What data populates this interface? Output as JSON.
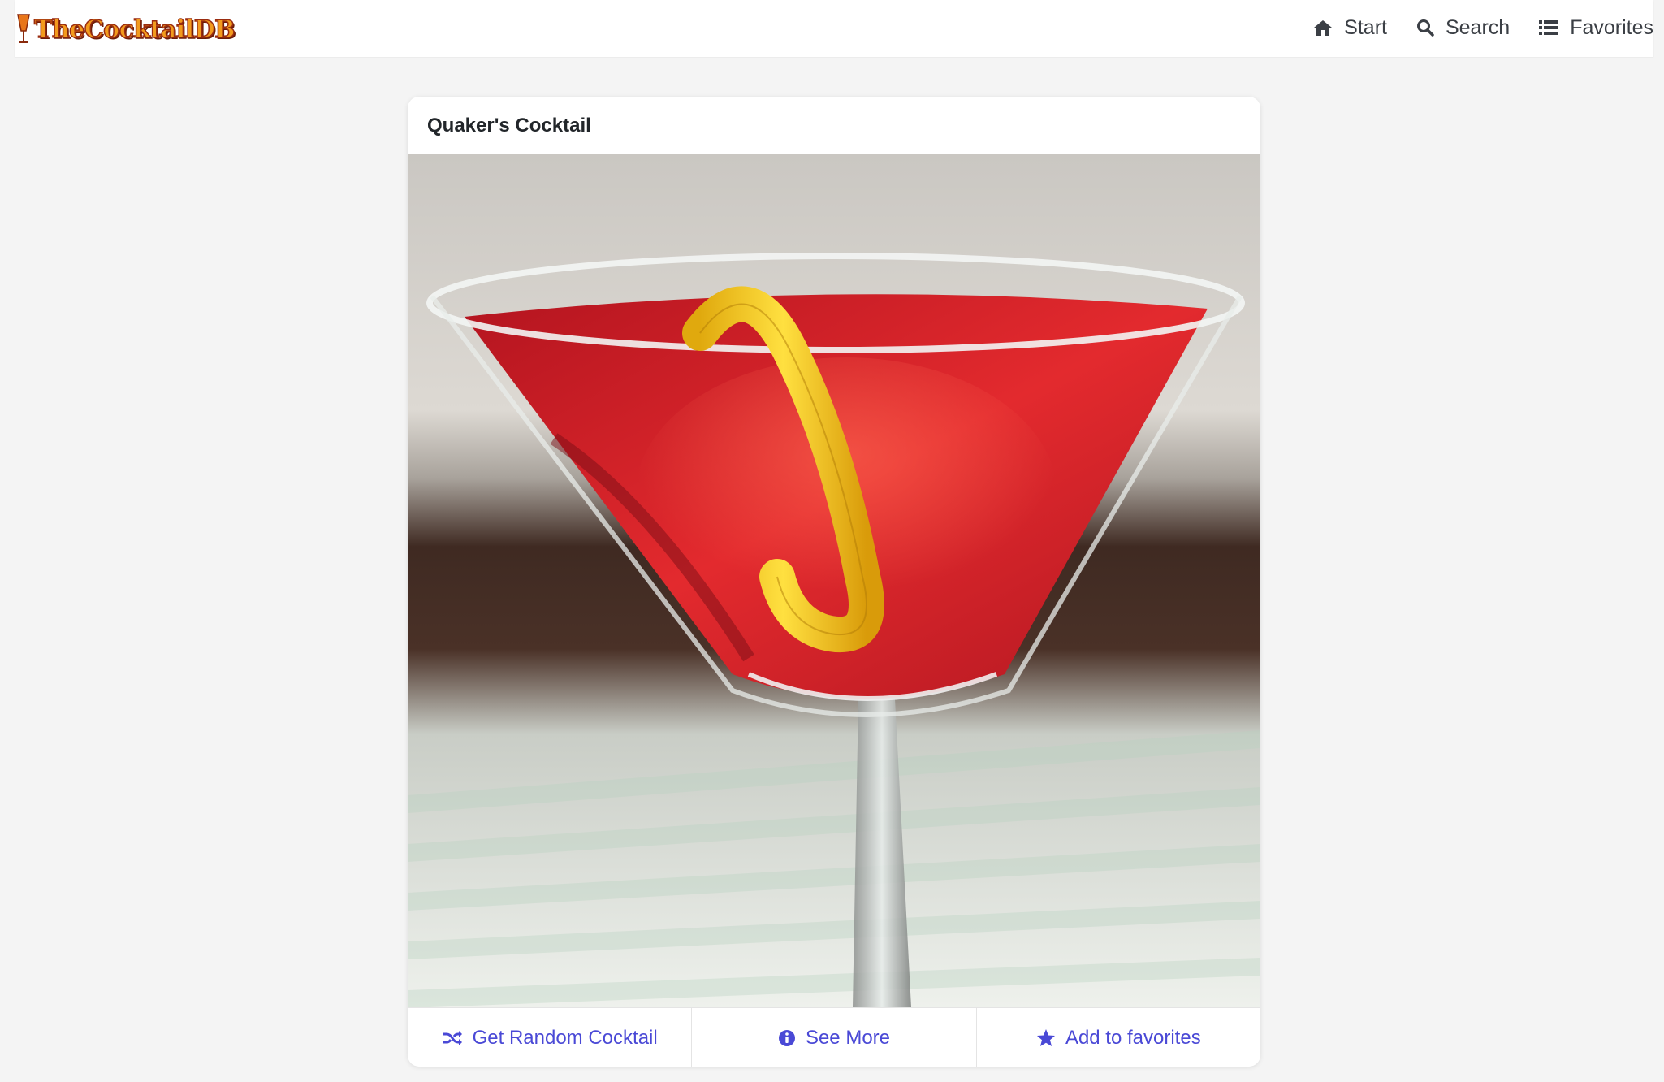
{
  "brand": {
    "name": "TheCocktailDB"
  },
  "nav": {
    "items": [
      {
        "label": "Start",
        "icon": "home-icon"
      },
      {
        "label": "Search",
        "icon": "search-icon"
      },
      {
        "label": "Favorites",
        "icon": "list-icon"
      }
    ]
  },
  "cocktail": {
    "name": "Quaker's Cocktail"
  },
  "actions": {
    "random_label": "Get Random Cocktail",
    "random_icon": "shuffle-icon",
    "more_label": "See More",
    "more_icon": "info-circle-icon",
    "favorite_label": "Add to favorites",
    "favorite_icon": "star-icon"
  },
  "colors": {
    "accent": "#4a49d6",
    "nav_text": "#3b3f45",
    "page_background": "#f4f4f4",
    "drink": "#d91f2e",
    "garnish": "#f2c91a"
  }
}
